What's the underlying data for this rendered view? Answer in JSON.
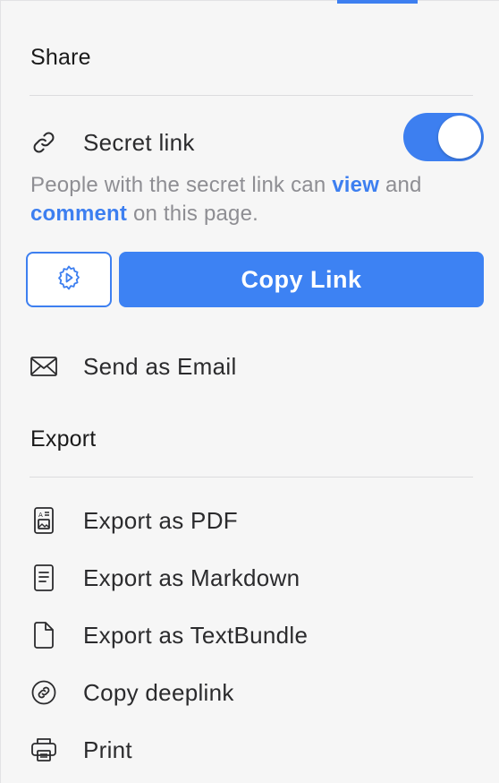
{
  "colors": {
    "accent": "#3d7ff0",
    "background": "#f6f6f6",
    "muted_text": "#8e8e93"
  },
  "share": {
    "title": "Share",
    "secret_link": {
      "icon": "link-icon",
      "label": "Secret link",
      "enabled": true
    },
    "description": {
      "part1": "People with the secret link can ",
      "view": "view",
      "part2": " and ",
      "comment": "comment",
      "part3": " on this page."
    },
    "settings_button_icon": "gear-icon",
    "copy_link_label": "Copy Link",
    "send_email": {
      "icon": "envelope-icon",
      "label": "Send as Email"
    }
  },
  "export": {
    "title": "Export",
    "items": [
      {
        "icon": "pdf-document-icon",
        "label": "Export as PDF"
      },
      {
        "icon": "markdown-document-icon",
        "label": "Export as Markdown"
      },
      {
        "icon": "file-icon",
        "label": "Export as TextBundle"
      },
      {
        "icon": "deeplink-icon",
        "label": "Copy deeplink"
      },
      {
        "icon": "printer-icon",
        "label": "Print"
      }
    ]
  }
}
